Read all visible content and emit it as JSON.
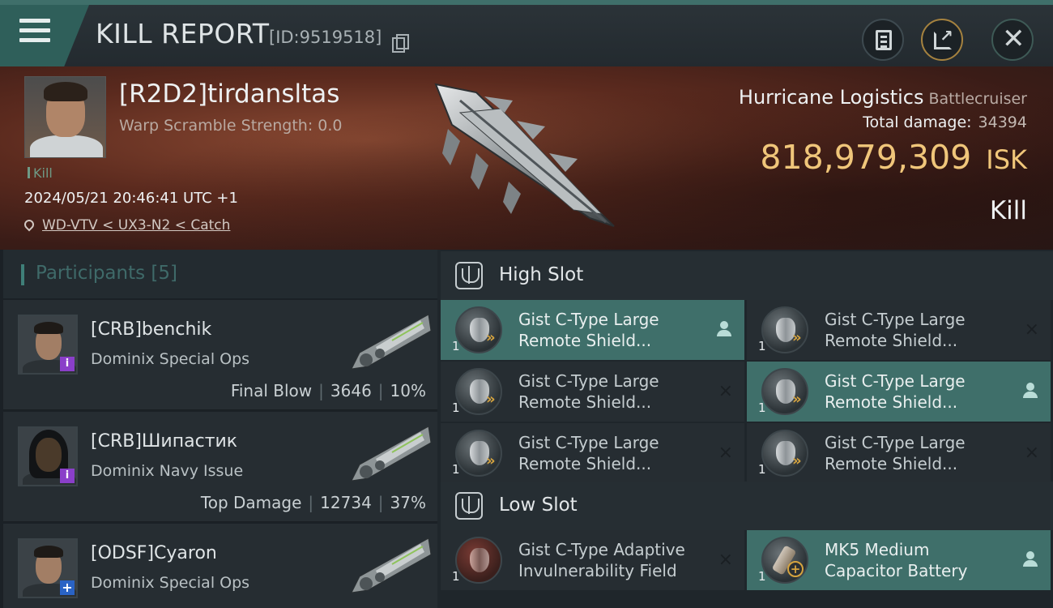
{
  "header": {
    "title": "KILL REPORT",
    "report_id": "[ID:9519518]",
    "icons": [
      "menu-icon",
      "copy-icon",
      "clipboard-icon",
      "export-icon",
      "close-icon"
    ]
  },
  "victim": {
    "name": "[R2D2]tirdansltas",
    "warp_scramble": "Warp Scramble Strength: 0.0",
    "kill_tag": "Kill",
    "datetime": "2024/05/21 20:46:41 UTC +1",
    "location": "WD-VTV < UX3-N2 < Catch",
    "ship_name": "Hurricane Logistics",
    "ship_class": "Battlecruiser",
    "total_damage_label": "Total damage:",
    "total_damage_value": "34394",
    "isk_amount": "818,979,309",
    "isk_unit": "ISK",
    "result": "Kill"
  },
  "participants": {
    "label": "Participants",
    "count": "[5]",
    "rows": [
      {
        "name": "[CRB]benchik",
        "ship": "Dominix Special Ops",
        "role": "Final Blow",
        "damage": "3646",
        "percent": "10%",
        "badge": "i"
      },
      {
        "name": "[CRB]Шипастик",
        "ship": "Dominix Navy Issue",
        "role": "Top Damage",
        "damage": "12734",
        "percent": "37%",
        "badge": "i"
      },
      {
        "name": "[ODSF]Cyaron",
        "ship": "Dominix Special Ops",
        "badge": "+"
      }
    ]
  },
  "high_slot": {
    "title": "High Slot",
    "modules": [
      {
        "qty": "1",
        "name": "Gist C-Type Large Remote Shield...",
        "status": "person"
      },
      {
        "qty": "1",
        "name": "Gist C-Type Large Remote Shield...",
        "status": "×"
      },
      {
        "qty": "1",
        "name": "Gist C-Type Large Remote Shield...",
        "status": "×"
      },
      {
        "qty": "1",
        "name": "Gist C-Type Large Remote Shield...",
        "status": "person"
      },
      {
        "qty": "1",
        "name": "Gist C-Type Large Remote Shield...",
        "status": "×"
      },
      {
        "qty": "1",
        "name": "Gist C-Type Large Remote Shield...",
        "status": "×"
      }
    ]
  },
  "low_slot": {
    "title": "Low Slot",
    "modules": [
      {
        "qty": "1",
        "name": "Gist C-Type Adaptive Invulnerability Field",
        "status": "×"
      },
      {
        "qty": "1",
        "name": "MK5 Medium Capacitor Battery",
        "status": "person"
      }
    ]
  },
  "colors": {
    "accent": "#3f6f6a",
    "isk": "#f0c67a",
    "banner": "#5b2a1e"
  }
}
